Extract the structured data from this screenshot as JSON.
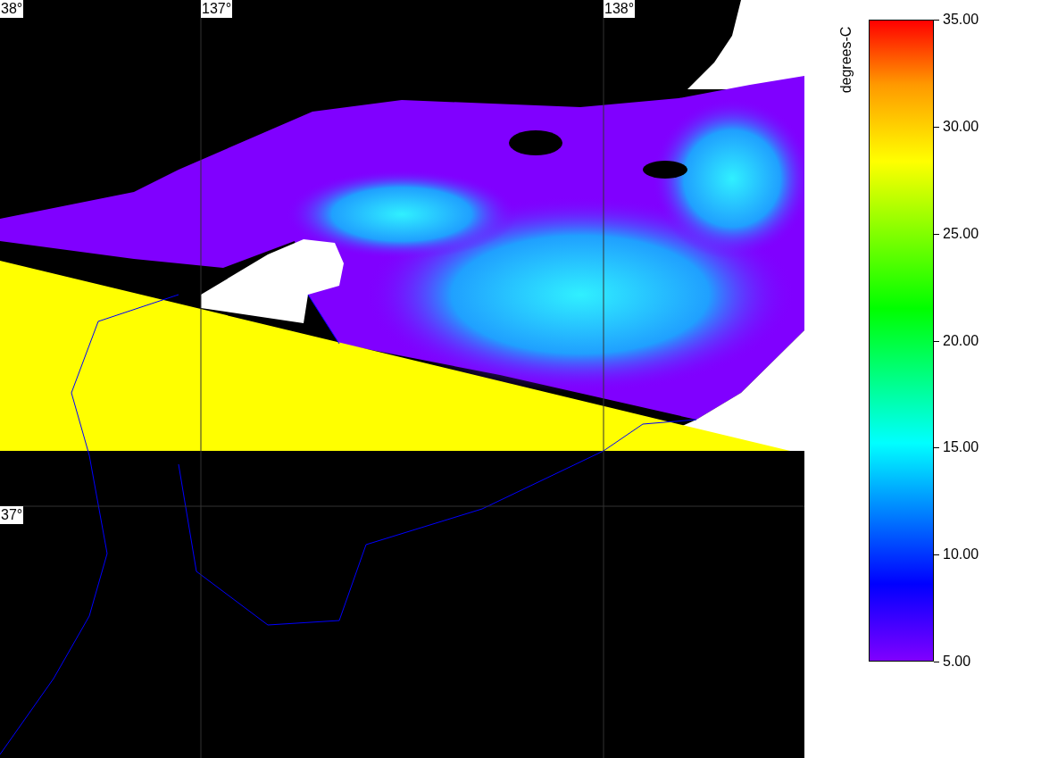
{
  "map": {
    "grid_labels": [
      {
        "text": "38°"
      },
      {
        "text": "137°"
      },
      {
        "text": "138°"
      },
      {
        "text": "37°"
      }
    ]
  },
  "colorbar": {
    "title": "degrees-C",
    "tick_labels": [
      "35.00",
      "30.00",
      "25.00",
      "20.00",
      "15.00",
      "10.00",
      "5.00"
    ]
  }
}
